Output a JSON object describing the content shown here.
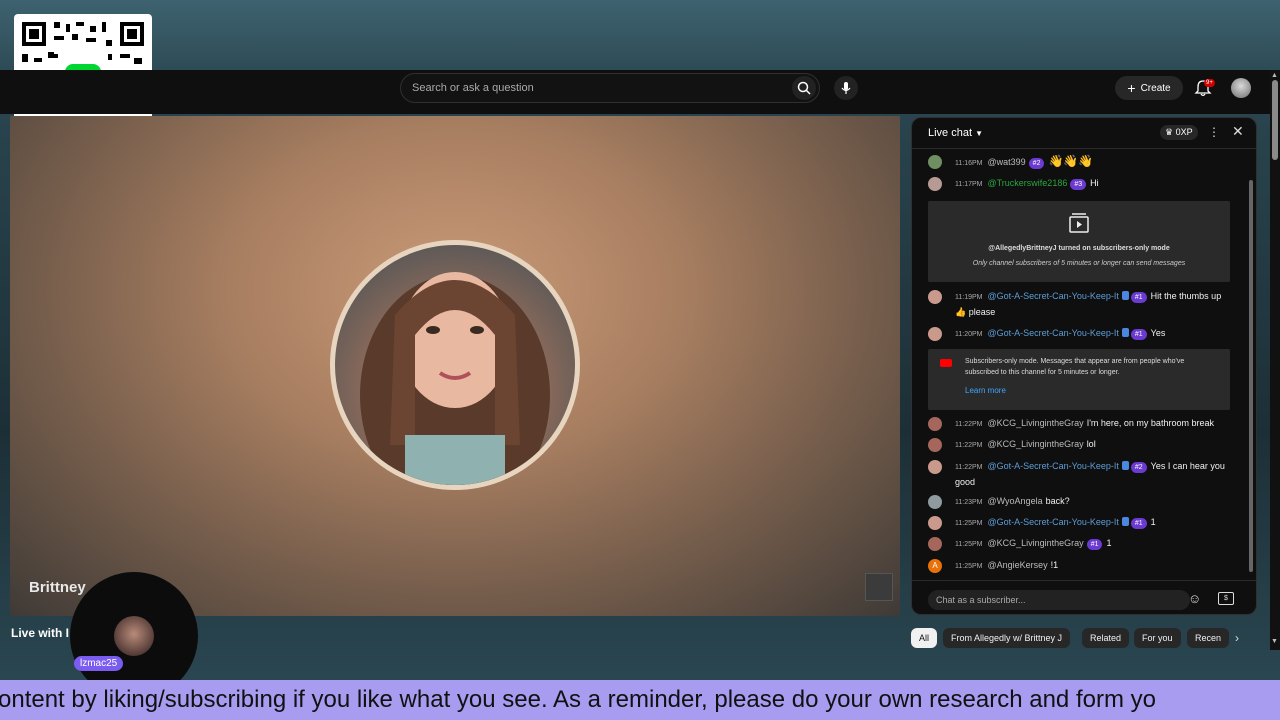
{
  "search": {
    "placeholder": "Search or ask a question"
  },
  "header": {
    "create_label": "Create",
    "notif_count": "9+"
  },
  "stream": {
    "overlay_name": "Brittney",
    "title_partial": "Live with I",
    "cam_label": "lzmac25"
  },
  "chat": {
    "title": "Live chat",
    "xp": "0XP",
    "messages": [
      {
        "time": "11:16PM",
        "author": "@wat399",
        "rank": "#2",
        "text": "👋👋👋"
      },
      {
        "time": "11:17PM",
        "author": "@Truckerswife2186",
        "rank": "#3",
        "text": "Hi"
      },
      {
        "time": "11:19PM",
        "author": "@Got-A-Secret-Can-You-Keep-It",
        "rank": "#1",
        "text": "Hit the thumbs up 👍 please"
      },
      {
        "time": "11:20PM",
        "author": "@Got-A-Secret-Can-You-Keep-It",
        "rank": "#1",
        "text": "Yes"
      },
      {
        "time": "11:22PM",
        "author": "@KCG_LivingintheGray",
        "rank": "",
        "text": "I'm here, on my bathroom break"
      },
      {
        "time": "11:22PM",
        "author": "@KCG_LivingintheGray",
        "rank": "",
        "text": "lol"
      },
      {
        "time": "11:22PM",
        "author": "@Got-A-Secret-Can-You-Keep-It",
        "rank": "#2",
        "text": "Yes I can hear you good"
      },
      {
        "time": "11:23PM",
        "author": "@WyoAngela",
        "rank": "",
        "text": "back?"
      },
      {
        "time": "11:25PM",
        "author": "@Got-A-Secret-Can-You-Keep-It",
        "rank": "#1",
        "text": "1"
      },
      {
        "time": "11:25PM",
        "author": "@KCG_LivingintheGray",
        "rank": "#1",
        "text": "1"
      },
      {
        "time": "11:25PM",
        "author": "@AngieKersey",
        "rank": "",
        "text": "!1"
      }
    ],
    "system1": {
      "line1": "@AllegedlyBrittneyJ turned on subscribers-only mode",
      "line2": "Only channel subscribers of 5 minutes or longer can send messages"
    },
    "system2": {
      "text": "Subscribers-only mode. Messages that appear are from people who've subscribed to this channel for 5 minutes or longer.",
      "link": "Learn more"
    },
    "input_placeholder": "Chat as a subscriber...",
    "avatar_initial_last": "A"
  },
  "chips": [
    "All",
    "From Allegedly w/ Brittney J",
    "Related",
    "For you",
    "Recen"
  ],
  "ticker": {
    "text": "ontent by liking/subscribing if you like what you see. As a reminder, please do your own research and form yo"
  },
  "colors": {
    "accent_purple": "#6a3ad1",
    "ticker_bg": "#a89cf0",
    "cashapp_green": "#00d632"
  }
}
